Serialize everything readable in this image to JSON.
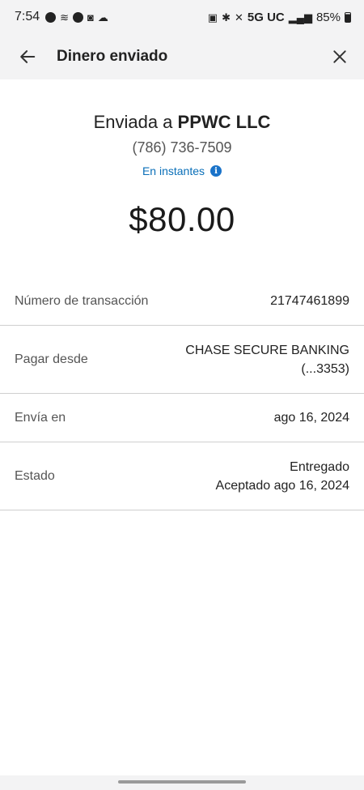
{
  "status_bar": {
    "time": "7:54",
    "network": "5G UC",
    "battery": "85%"
  },
  "header": {
    "title": "Dinero enviado",
    "back_icon": "arrow-left-icon",
    "close_icon": "close-icon"
  },
  "summary": {
    "sent_to_prefix": "Enviada a",
    "recipient": "PPWC LLC",
    "phone": "(786) 736-7509",
    "delivery_speed": "En instantes",
    "amount": "$80.00"
  },
  "details": [
    {
      "label": "Número de transacción",
      "value": [
        "21747461899"
      ]
    },
    {
      "label": "Pagar desde",
      "value": [
        "CHASE SECURE BANKING",
        "(...3353)"
      ]
    },
    {
      "label": "Envía en",
      "value": [
        "ago 16, 2024"
      ]
    },
    {
      "label": "Estado",
      "value": [
        "Entregado",
        "Aceptado ago 16, 2024"
      ]
    }
  ],
  "colors": {
    "link": "#0a6fb8",
    "header_bg": "#f3f3f4"
  }
}
